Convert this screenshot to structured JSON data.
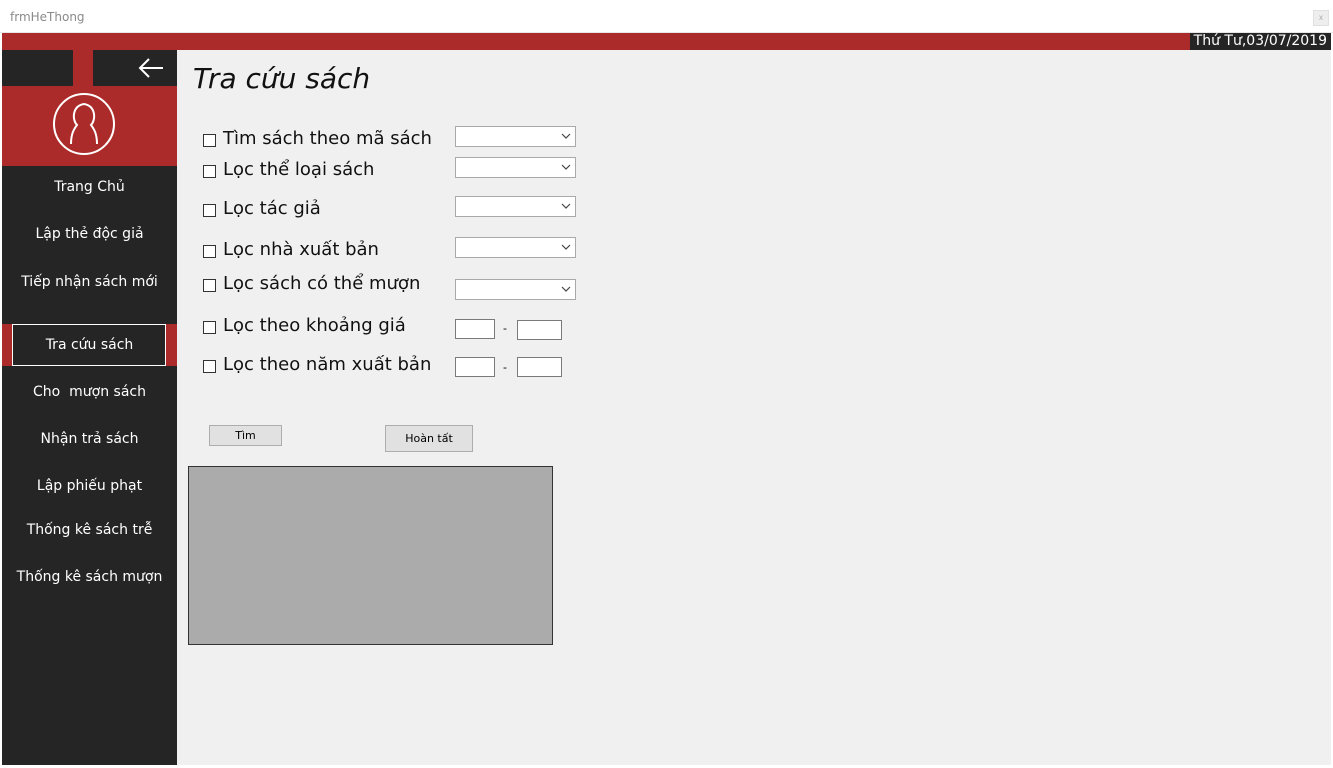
{
  "window": {
    "title": "frmHeThong",
    "close_icon": "close-icon"
  },
  "header": {
    "date": "Thứ Tư,03/07/2019"
  },
  "colors": {
    "accent": "#ab2b2b",
    "sidebar": "#252525",
    "content": "#f0f0f0",
    "grid": "#ababab"
  },
  "sidebar": {
    "back_icon": "arrow-left-icon",
    "avatar_icon": "user-silhouette-icon",
    "items": [
      {
        "label": "Trang Chủ",
        "active": false
      },
      {
        "label": "Lập thẻ độc giả",
        "active": false
      },
      {
        "label": "Tiếp nhận sách mới",
        "active": false
      },
      {
        "label": "Tra cứu sách",
        "active": true
      },
      {
        "label": "Cho  mượn sách",
        "active": false
      },
      {
        "label": "Nhận trả sách",
        "active": false
      },
      {
        "label": "Lập phiếu phạt",
        "active": false
      },
      {
        "label": "Thống kê sách trễ",
        "active": false
      },
      {
        "label": "Thống kê sách mượn",
        "active": false
      }
    ]
  },
  "main": {
    "title": "Tra cứu sách",
    "filters": [
      {
        "label": "Tìm sách theo mã sách",
        "checked": false,
        "input": "combo",
        "value": ""
      },
      {
        "label": "Lọc thể loại sách",
        "checked": false,
        "input": "combo",
        "value": ""
      },
      {
        "label": "Lọc tác giả",
        "checked": false,
        "input": "combo",
        "value": ""
      },
      {
        "label": "Lọc nhà xuất bản",
        "checked": false,
        "input": "combo",
        "value": ""
      },
      {
        "label": "Lọc sách có thể mượn",
        "checked": false,
        "input": "combo",
        "value": ""
      },
      {
        "label": "Lọc theo khoảng giá",
        "checked": false,
        "input": "range",
        "from": "",
        "to": "",
        "separator": "-"
      },
      {
        "label": "Lọc theo năm xuất bản",
        "checked": false,
        "input": "range",
        "from": "",
        "to": "",
        "separator": "-"
      }
    ],
    "buttons": {
      "search": "Tìm",
      "done": "Hoàn tất"
    }
  }
}
